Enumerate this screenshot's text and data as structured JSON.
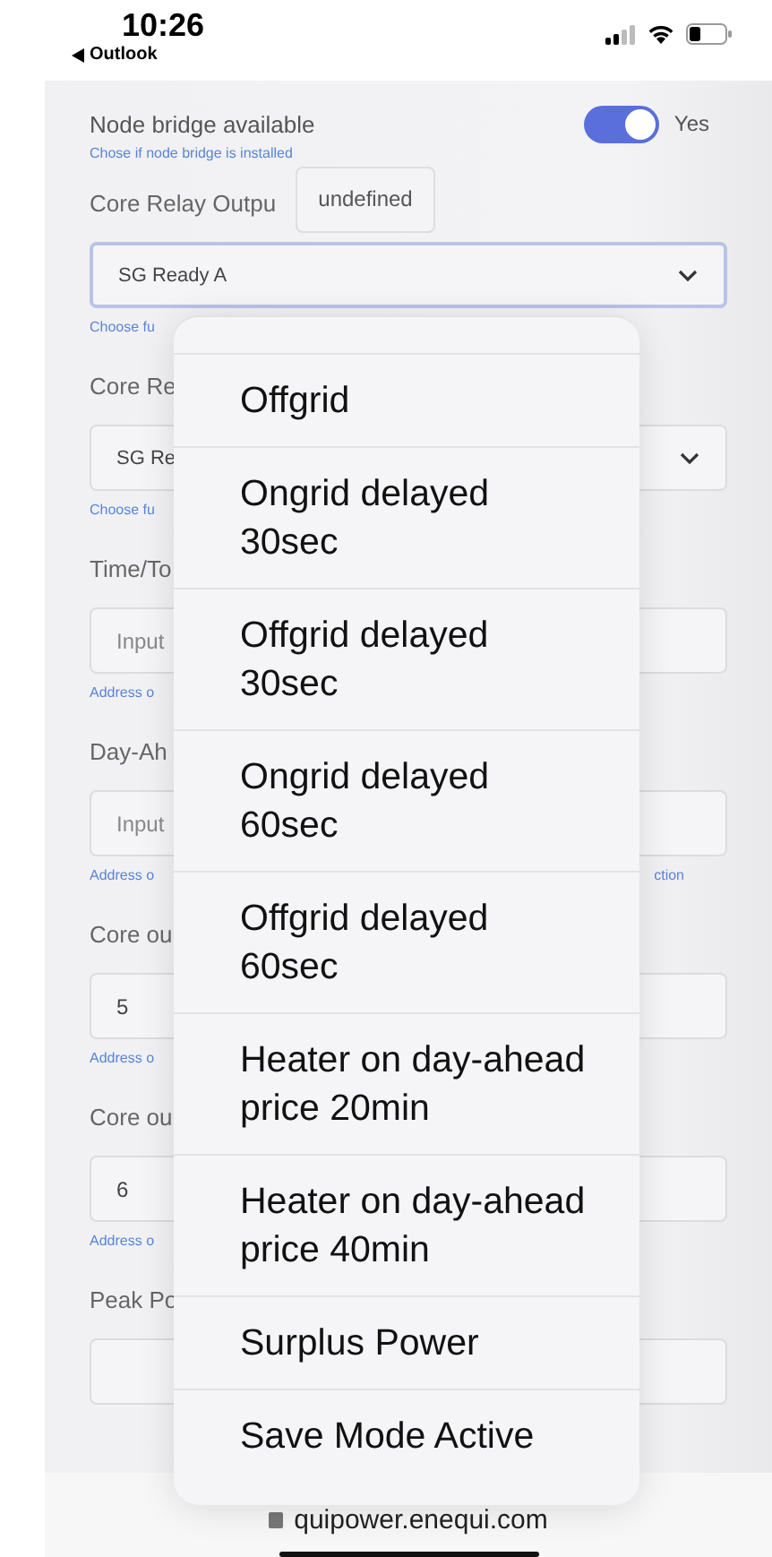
{
  "status_bar": {
    "time": "10:26",
    "back_label": "Outlook"
  },
  "toggle": {
    "label": "Node bridge available",
    "hint": "Chose if node bridge is installed",
    "on": true,
    "value": "Yes"
  },
  "tooltip": "undefined",
  "fields": [
    {
      "kind": "select",
      "label": "Core Relay Outpu",
      "value": "SG Ready A",
      "hint": "Choose fu",
      "focused": true
    },
    {
      "kind": "select",
      "label": "Core Re",
      "value": "SG Re",
      "hint": "Choose fu",
      "focused": false
    },
    {
      "kind": "input",
      "label": "Time/To",
      "placeholder": "Input",
      "hint": "Address o",
      "focused": false
    },
    {
      "kind": "input",
      "label": "Day-Ah",
      "placeholder": "Input",
      "hint": "Address o",
      "hint_end": "ction",
      "focused": false
    },
    {
      "kind": "input",
      "label": "Core ou",
      "value": "5",
      "hint": "Address o",
      "focused": false
    },
    {
      "kind": "input",
      "label": "Core ou",
      "value": "6",
      "hint": "Address o",
      "focused": false
    },
    {
      "kind": "input",
      "label": "Peak Po",
      "focused": false
    }
  ],
  "dropdown": {
    "options": [
      "Offgrid",
      "Ongrid delayed 30sec",
      "Offgrid delayed 30sec",
      "Ongrid delayed 60sec",
      "Offgrid delayed 60sec",
      "Heater on day-ahead price 20min",
      "Heater on day-ahead price 40min",
      "Surplus Power",
      "Save Mode Active"
    ]
  },
  "browser_bar": {
    "url": "quipower.enequi.com"
  }
}
